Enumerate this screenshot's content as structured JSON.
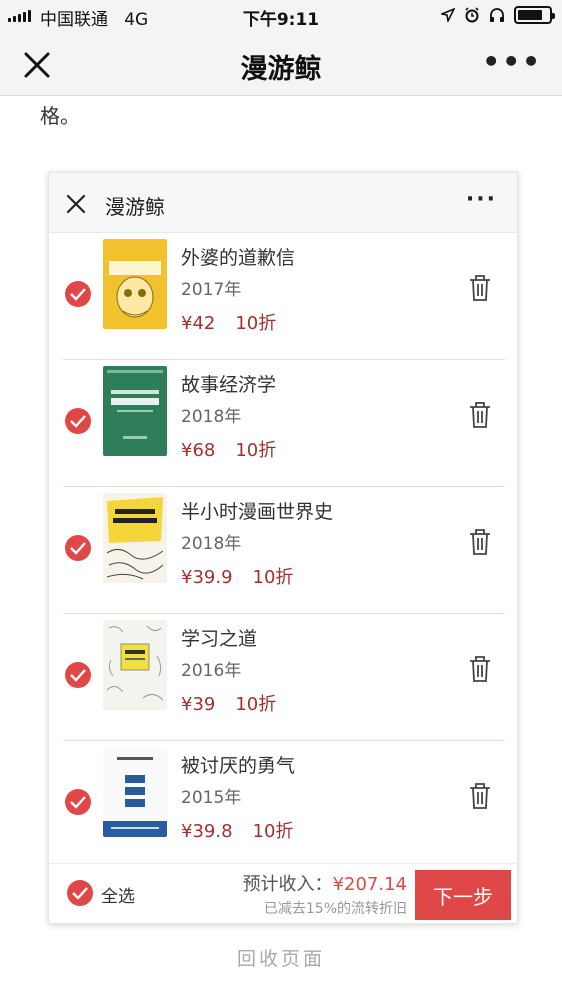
{
  "status_bar": {
    "carrier": "中国联通",
    "network": "4G",
    "time": "下午9:11"
  },
  "nav": {
    "title": "漫游鲸",
    "close_icon": "close-icon",
    "more_icon": "more-icon"
  },
  "article": {
    "text": "格。"
  },
  "embedded": {
    "title": "漫游鲸",
    "items": [
      {
        "title": "外婆的道歉信",
        "year": "2017年",
        "price": "¥42",
        "discount": "10折",
        "checked": true
      },
      {
        "title": "故事经济学",
        "year": "2018年",
        "price": "¥68",
        "discount": "10折",
        "checked": true
      },
      {
        "title": "半小时漫画世界史",
        "year": "2018年",
        "price": "¥39.9",
        "discount": "10折",
        "checked": true
      },
      {
        "title": "学习之道",
        "year": "2016年",
        "price": "¥39",
        "discount": "10折",
        "checked": true
      },
      {
        "title": "被讨厌的勇气",
        "year": "2015年",
        "price": "¥39.8",
        "discount": "10折",
        "checked": true
      }
    ],
    "footer": {
      "select_all": "全选",
      "estimate_label": "预计收入：",
      "estimate_amount": "¥207.14",
      "note": "已减去15%的流转折旧",
      "next_button": "下一步"
    }
  },
  "recycle_text": "回收页面",
  "colors": {
    "accent": "#e04848",
    "price": "#a33030",
    "nav_bg": "#f4f4f4"
  }
}
